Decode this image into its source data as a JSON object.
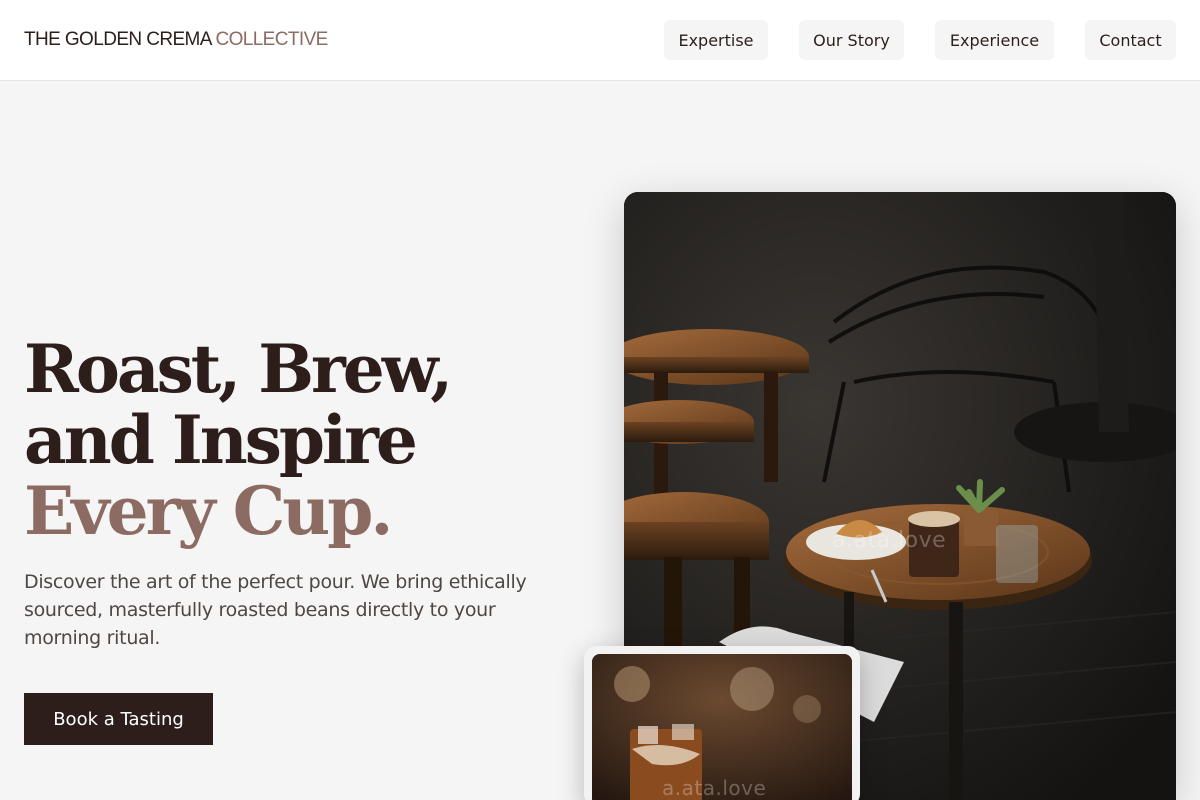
{
  "header": {
    "brand_primary": "THE GOLDEN CREMA",
    "brand_accent": "COLLECTIVE",
    "nav": {
      "expertise": "Expertise",
      "our_story": "Our Story",
      "experience": "Experience",
      "contact": "Contact"
    }
  },
  "hero": {
    "headline_line1": "Roast, Brew,",
    "headline_line2": "and Inspire",
    "headline_line3": "Every Cup.",
    "description": "Discover the art of the perfect pour. We bring ethically sourced, masterfully roasted beans directly to your morning ritual.",
    "cta_label": "Book a Tasting"
  },
  "images": {
    "main_watermark": "a.ata.love",
    "inset_watermark": "a.ata.love"
  },
  "colors": {
    "primary_dark": "#2d1e1b",
    "accent": "#8c6b62",
    "background": "#f5f5f5"
  }
}
